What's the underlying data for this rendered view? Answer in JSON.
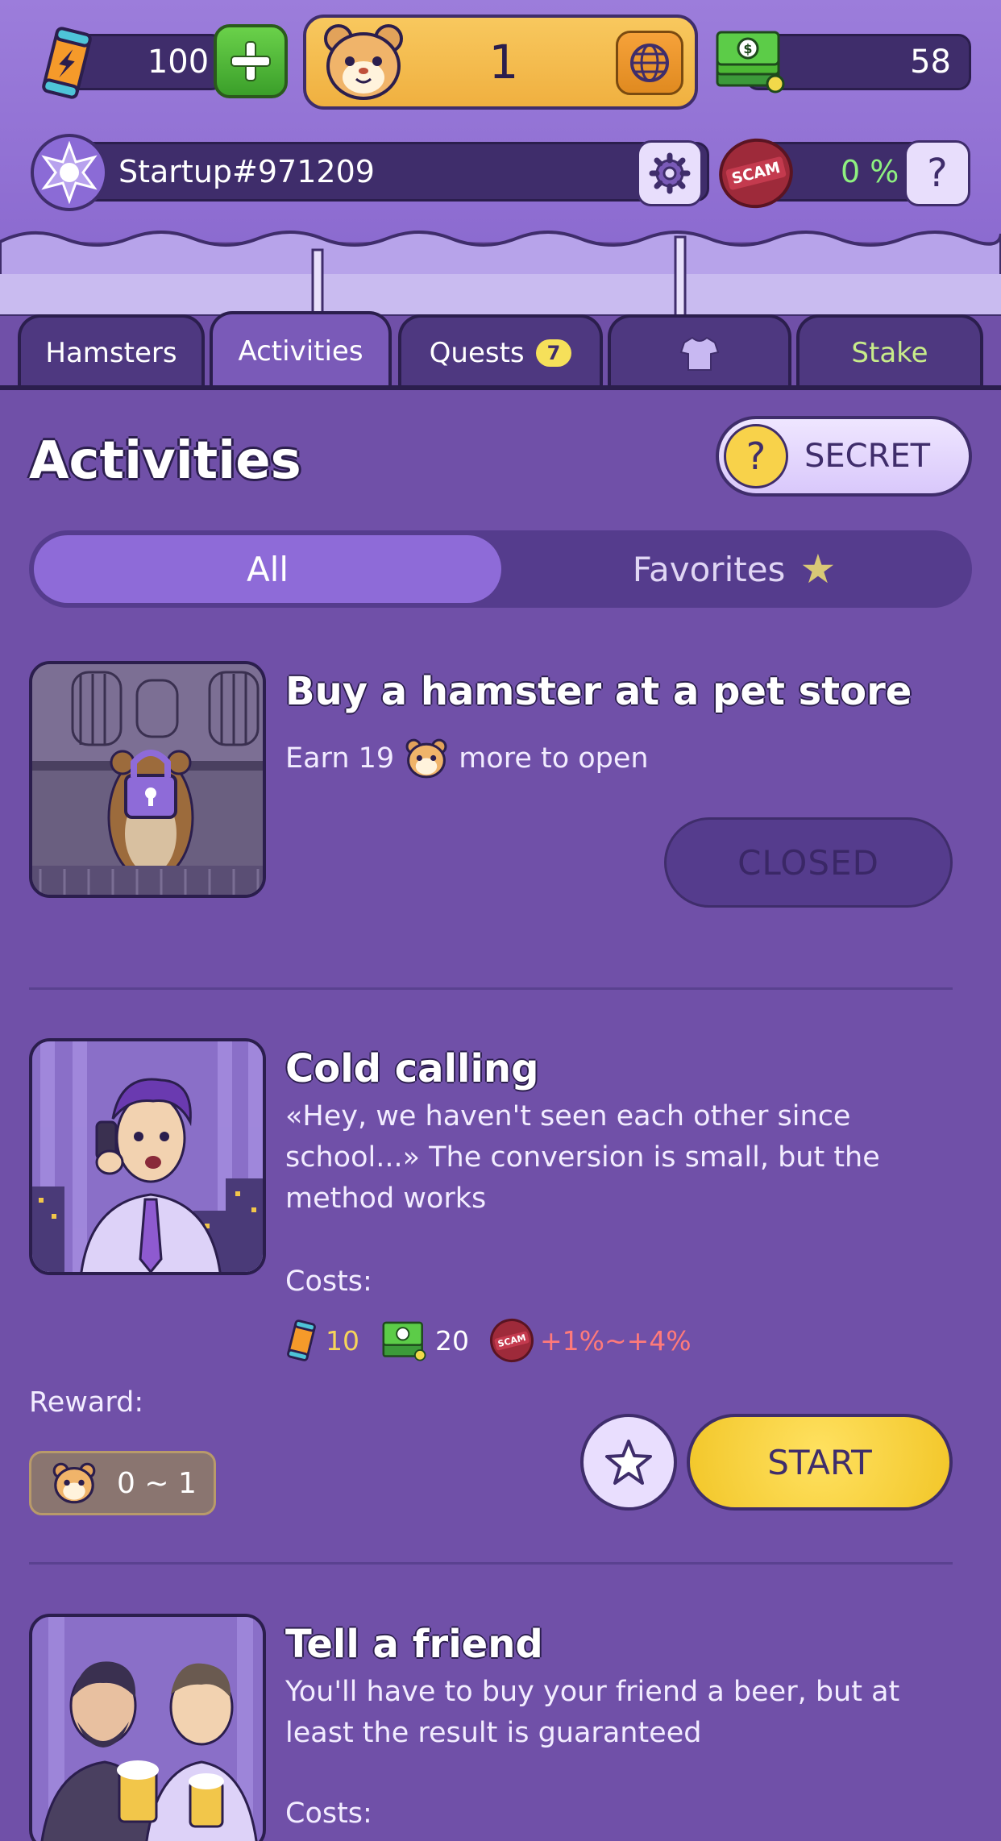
{
  "top": {
    "energy": "100",
    "hamsters": "1",
    "cash": "58"
  },
  "startup": {
    "name": "Startup#971209",
    "scam_percent": "0 %",
    "scam_badge": "SCAM",
    "help": "?"
  },
  "tabs": [
    {
      "label": "Hamsters"
    },
    {
      "label": "Activities"
    },
    {
      "label": "Quests",
      "badge": "7"
    },
    {
      "label": "",
      "icon": "shirt-icon"
    },
    {
      "label": "Stake"
    }
  ],
  "header": {
    "title": "Activities",
    "secret_label": "SECRET",
    "secret_icon": "?"
  },
  "filter": {
    "all": "All",
    "favorites": "Favorites"
  },
  "activities": [
    {
      "title": "Buy a hamster at a pet store",
      "earn_prefix": "Earn 19",
      "earn_suffix": "more to open",
      "button": "CLOSED"
    },
    {
      "title": "Cold calling",
      "desc_line1": "«Hey, we haven't seen each other since",
      "desc_line2": "school...» The conversion is small, but the",
      "desc_line3": "method works",
      "costs_label": "Costs:",
      "cost_energy": "10",
      "cost_cash": "20",
      "cost_scam": "+1%~+4%",
      "scam_badge": "SCAM",
      "reward_label": "Reward:",
      "reward_value": "0 ~ 1",
      "button": "START"
    },
    {
      "title": "Tell a friend",
      "desc_line1": "You'll have to buy your friend a beer, but at",
      "desc_line2": "least the result is guaranteed",
      "costs_label": "Costs:"
    }
  ],
  "colors": {
    "background": "#7050a8",
    "dark": "#2b1e4d",
    "yellow": "#f2c628",
    "green": "#4cb834",
    "scam_red": "#9e2a3a"
  }
}
